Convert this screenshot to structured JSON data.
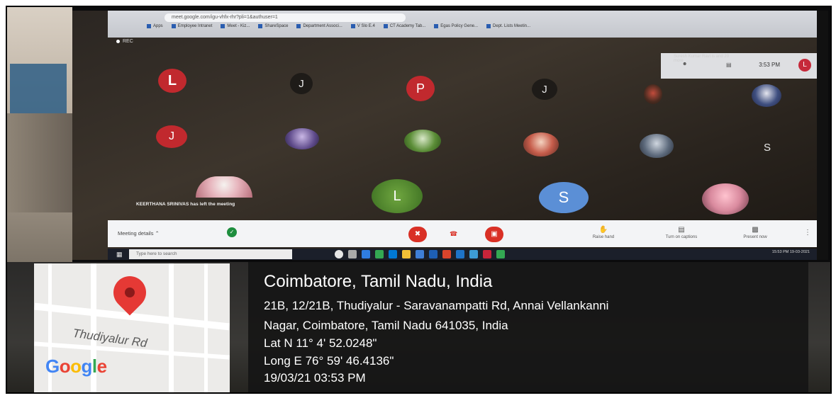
{
  "browser": {
    "url": "meet.google.com/igu-vhfx-rhr?pli=1&authuser=1",
    "bookmarks": [
      "Apps",
      "Employee Intranet",
      "Meet - Kiz...",
      "ShareSpace",
      "Department Associ...",
      "V Slo E.4",
      "CT Academy Tab...",
      "Egas Policy Gene...",
      "Dept. Lists Meetin..."
    ]
  },
  "meet": {
    "rec_label": "REC",
    "presenter_name": "Suresh Kumar Ravi is and 20 more",
    "panel_time": "3:53 PM",
    "panel_avatar": "L",
    "toast": "KEERTHANA SRINIVAS has left the meeting",
    "meeting_details": "Meeting details",
    "raise_hand": "Raise hand",
    "turn_on_captions": "Turn on captions",
    "present_now": "Present now",
    "participants": [
      {
        "letter": "L"
      },
      {
        "letter": "J"
      },
      {
        "letter": "P"
      },
      {
        "letter": "J"
      },
      {
        "letter": ""
      },
      {
        "letter": ""
      },
      {
        "letter": "J"
      },
      {
        "letter": ""
      },
      {
        "letter": ""
      },
      {
        "letter": ""
      },
      {
        "letter": ""
      },
      {
        "letter": "S"
      },
      {
        "letter": ""
      },
      {
        "letter": "L"
      },
      {
        "letter": "S"
      },
      {
        "letter": ""
      }
    ]
  },
  "taskbar": {
    "search_placeholder": "Type here to search",
    "tray_time": "15:53 PM",
    "tray_date": "19-03-2021"
  },
  "location": {
    "title": "Coimbatore, Tamil Nadu, India",
    "address_line1": "21B, 12/21B, Thudiyalur - Saravanampatti Rd, Annai Vellankanni",
    "address_line2": "Nagar, Coimbatore, Tamil Nadu 641035, India",
    "lat": "Lat N 11° 4' 52.0248\"",
    "long": "Long E 76° 59' 46.4136\"",
    "datetime": "19/03/21 03:53 PM"
  },
  "map": {
    "road_label": "Thudiyalur Rd",
    "logo_letters": [
      "G",
      "o",
      "o",
      "g",
      "l",
      "e"
    ],
    "logo_colors": [
      "#4285F4",
      "#EA4335",
      "#FBBC05",
      "#4285F4",
      "#34A853",
      "#EA4335"
    ],
    "pin_color": "#E53935",
    "icon": "map-pin-icon"
  }
}
